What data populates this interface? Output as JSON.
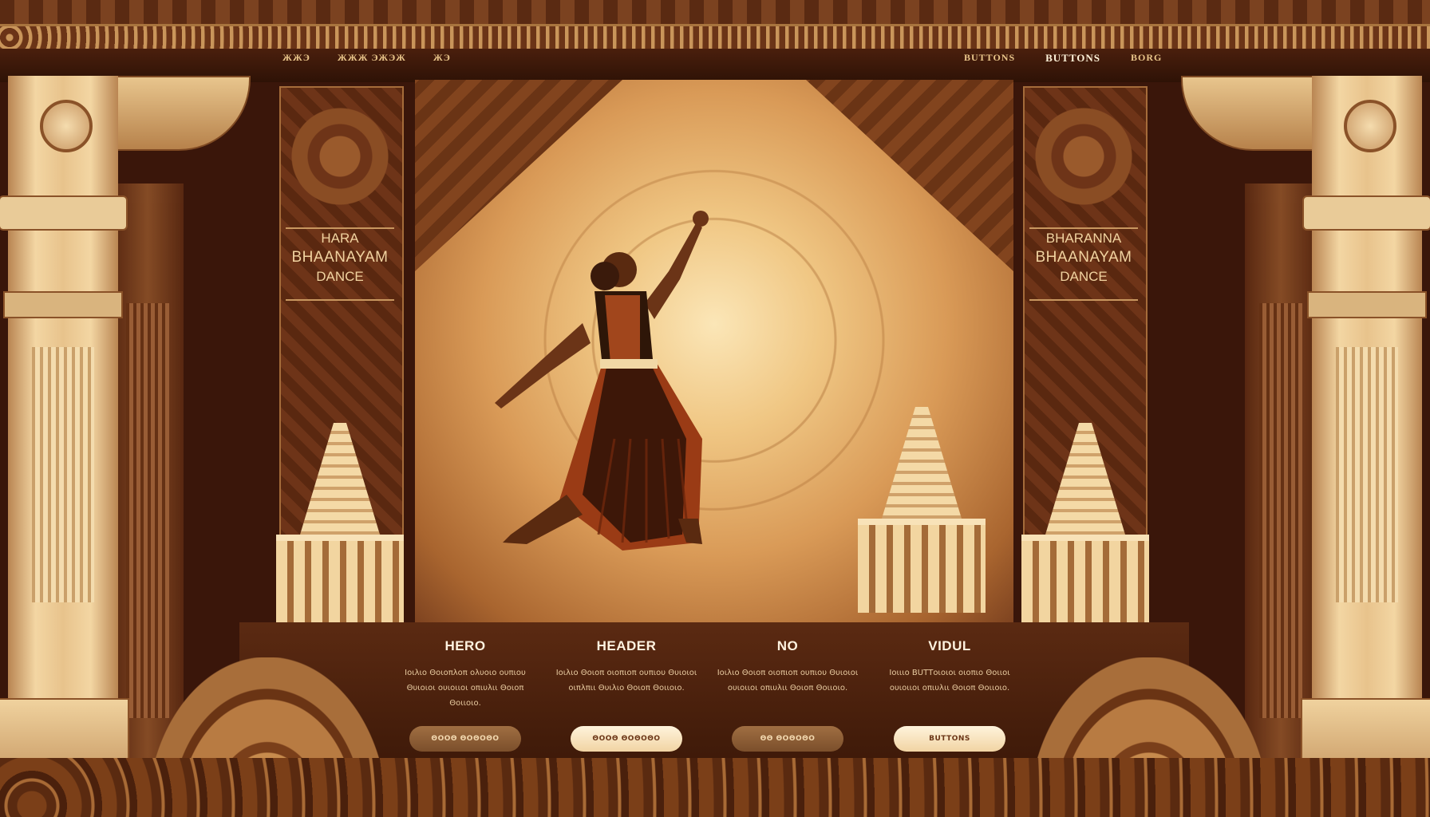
{
  "nav": {
    "left_items": [
      "ЖЖЭ",
      "ЖЖЖ ЭЖЭЖ",
      "ЖЭ"
    ],
    "right_items": [
      "BUTTONS",
      "BUTTONS",
      "BORG"
    ]
  },
  "panels": {
    "left": {
      "line1": "HARA",
      "line2": "BHAANAYAM",
      "line3": "DANCE"
    },
    "right": {
      "line1": "BHARANNA",
      "line2": "BHAANAYAM",
      "line3": "DANCE"
    }
  },
  "features": [
    {
      "heading": "HERO",
      "desc": "Ιοιλιο Θοιοπλοπ ολυοιο ουπιου Θυιοιοι ουιοιιοι οπιυλιι Θοιοπ Θοιιοιο.",
      "button": "ΘΟΟΘ ΘΟΘΟΘΟ",
      "style": "dark"
    },
    {
      "heading": "HEADER",
      "desc": "Ιοιλιο Θοιοπ οιοπιοπ ουπιου Θυιοιοι οιπλπιι Θυιλιο Θοιοπ Θοιιοιο.",
      "button": "ΘΟΟΘ ΘΟΘΟΘΟ",
      "style": "light"
    },
    {
      "heading": "NO",
      "desc": "Ιοιλιο Θοιοπ οιοπιοπ ουπιου Θυιοιοι ουιοιιοι οπιυλιι Θοιοπ Θοιιοιο.",
      "button": "ΘΘ ΘΟΘΟΘΟ",
      "style": "dark"
    },
    {
      "heading": "VIDUL",
      "desc": "Ιοιιιο BUTΤοιοιοι οιοπιο Θοιιοι ουιοιιοι οπιυλιι Θοιοπ Θοιιοιο.",
      "button": "BUTTONS",
      "style": "light"
    }
  ],
  "colors": {
    "background": "#3a160a",
    "gold": "#f1d3a0",
    "accent_dark": "#7b4f2b",
    "accent_light": "#fff4dc"
  }
}
